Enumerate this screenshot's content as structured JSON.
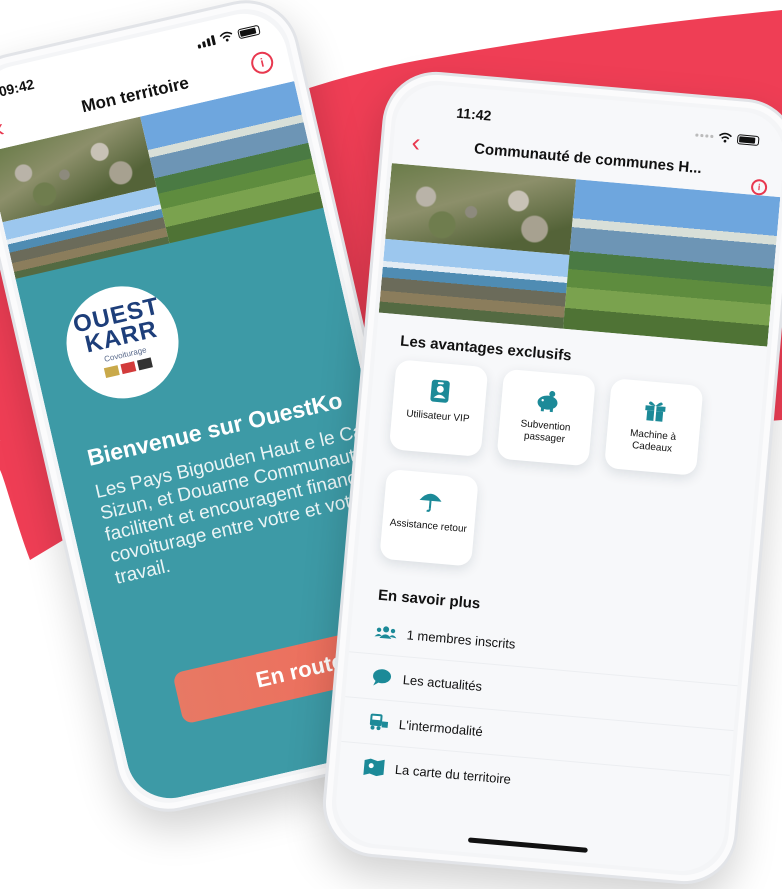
{
  "colors": {
    "accent": "#e8384f",
    "teal": "#3d9aa6",
    "brand_blue": "#1d3e7a",
    "perk_icon": "#1c8a98"
  },
  "left_phone": {
    "status": {
      "time": "09:42"
    },
    "header": {
      "title": "Mon territoire",
      "back_icon": "chevron-left-icon",
      "info_icon": "info-icon"
    },
    "logo": {
      "line1": "OUEST",
      "line2": "KARR",
      "subtitle": "Covoiturage"
    },
    "welcome": {
      "title": "Bienvenue sur OuestKo",
      "body": "Les Pays Bigouden Haut e le Cap-Sizun, et Douarne Communauté facilitent et encouragent financièren covoiturage entre votre et votre travail."
    },
    "cta": "En route"
  },
  "right_phone": {
    "status": {
      "time": "11:42"
    },
    "header": {
      "title": "Communauté de communes H...",
      "back_icon": "chevron-left-icon",
      "info_icon": "info-icon"
    },
    "perks_title": "Les avantages exclusifs",
    "perks": [
      {
        "label": "Utilisateur VIP",
        "icon": "id-badge-icon"
      },
      {
        "label": "Subvention passager",
        "icon": "piggy-bank-icon"
      },
      {
        "label": "Machine à Cadeaux",
        "icon": "gift-icon"
      },
      {
        "label": "Assistance retour",
        "icon": "umbrella-icon"
      }
    ],
    "more_title": "En savoir plus",
    "more_items": [
      {
        "label": "1 membres inscrits",
        "icon": "users-icon"
      },
      {
        "label": "Les actualités",
        "icon": "chat-bubble-icon"
      },
      {
        "label": "L'intermodalité",
        "icon": "bus-icon"
      },
      {
        "label": "La carte du territoire",
        "icon": "map-icon"
      }
    ]
  }
}
